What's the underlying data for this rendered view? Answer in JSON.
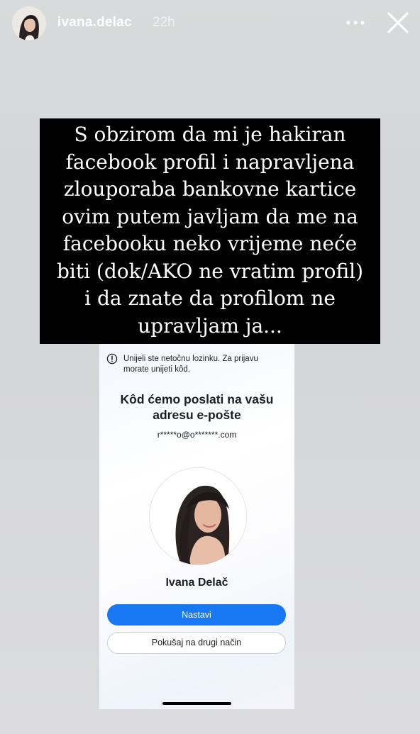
{
  "story_header": {
    "username": "ivana.delac",
    "time_ago": "22h",
    "avatar_icon": "profile-avatar",
    "more_icon": "more-horizontal-icon",
    "close_icon": "close-icon"
  },
  "caption": {
    "lines": [
      "S obzirom da mi je hakiran",
      "facebook profil i napravljena",
      "zlouporaba bankovne kartice",
      "ovim putem javljam da me na",
      "facebooku neko vrijeme neće",
      "biti (dok/AKO ne vratim profil)",
      "i da znate da profilom ne",
      "upravljam ja..."
    ]
  },
  "screenshot": {
    "alert_icon": "info-circle-icon",
    "alert_lines": [
      "Unijeli ste netočnu lozinku. Za prijavu",
      "morate unijeti kôd."
    ],
    "heading_lines": [
      "Kôd ćemo poslati na vašu",
      "adresu e-pošte"
    ],
    "masked_email": "r*****o@o*******.com",
    "profile_name": "Ivana Delač",
    "primary_button": "Nastavi",
    "secondary_button": "Pokušaj na drugi način"
  },
  "colors": {
    "accent_blue": "#1877f2",
    "caption_background": "#000000",
    "caption_text": "#ffffff"
  }
}
